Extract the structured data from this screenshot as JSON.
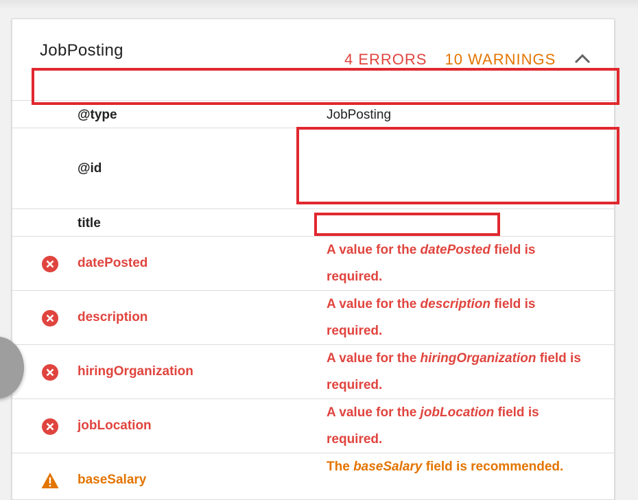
{
  "card": {
    "title": "JobPosting",
    "errors_label": "4 ERRORS",
    "warnings_label": "10 WARNINGS",
    "collapse_icon": "chevron-up-icon"
  },
  "fields": [
    {
      "key": "@type",
      "value": "JobPosting"
    },
    {
      "key": "@id",
      "value": ""
    },
    {
      "key": "title",
      "value": ""
    }
  ],
  "issues": [
    {
      "type": "error",
      "icon": "error-circle-icon",
      "key": "datePosted",
      "pre": "A value for the ",
      "em": "datePosted",
      "post": " field is required."
    },
    {
      "type": "error",
      "icon": "error-circle-icon",
      "key": "description",
      "pre": "A value for the ",
      "em": "description",
      "post": " field is required."
    },
    {
      "type": "error",
      "icon": "error-circle-icon",
      "key": "hiringOrganization",
      "pre": "A value for the ",
      "em": "hiringOrganization",
      "post": " field is required."
    },
    {
      "type": "error",
      "icon": "error-circle-icon",
      "key": "jobLocation",
      "pre": "A value for the ",
      "em": "jobLocation",
      "post": " field is required."
    },
    {
      "type": "warning",
      "icon": "warning-triangle-icon",
      "key": "baseSalary",
      "pre": "The ",
      "em": "baseSalary",
      "post": " field is recommended."
    }
  ],
  "colors": {
    "error": "#e0443e",
    "warning": "#e37400",
    "redaction": "#e0282e"
  }
}
